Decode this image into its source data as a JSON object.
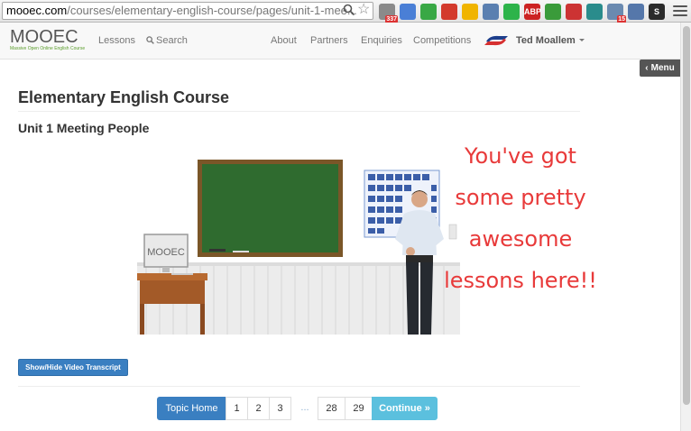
{
  "browser": {
    "url_host": "mooec.com",
    "url_path": "/courses/elementary-english-course/pages/unit-1-mee...",
    "extensions": [
      {
        "icon": "mail-icon",
        "badge": "337",
        "color": "#8a8a8a"
      },
      {
        "icon": "translate-icon",
        "badge": "",
        "color": "#4a7fd6"
      },
      {
        "icon": "evernote-icon",
        "badge": "",
        "color": "#39a845"
      },
      {
        "icon": "bookmark-red-icon",
        "badge": "",
        "color": "#d33a2c"
      },
      {
        "icon": "drive-icon",
        "badge": "",
        "color": "#f0b400"
      },
      {
        "icon": "clock-icon",
        "badge": "",
        "color": "#5a7fb0"
      },
      {
        "icon": "hangouts-icon",
        "badge": "",
        "color": "#2db34a"
      },
      {
        "icon": "adblock-icon",
        "label": "ABP",
        "badge": "",
        "color": "#c22"
      },
      {
        "icon": "feedly-icon",
        "badge": "",
        "color": "#3a9b3a"
      },
      {
        "icon": "plus-icon",
        "badge": "",
        "color": "#c33"
      },
      {
        "icon": "museum-icon",
        "badge": "",
        "color": "#2a8c8c"
      },
      {
        "icon": "calendar-icon",
        "badge": "15",
        "color": "#6a8ab0"
      },
      {
        "icon": "star-square-icon",
        "badge": "",
        "color": "#5577aa"
      },
      {
        "icon": "s-icon",
        "label": "S",
        "badge": "",
        "color": "#2b2b2b"
      }
    ]
  },
  "nav": {
    "logo_text": "MOOEC",
    "logo_tagline": "Massive Open Online English Course",
    "lessons": "Lessons",
    "search": "Search",
    "about": "About",
    "partners": "Partners",
    "enquiries": "Enquiries",
    "competitions": "Competitions",
    "user": "Ted Moallem"
  },
  "menu_label": "Menu",
  "course_title": "Elementary English Course",
  "unit_title": "Unit 1 Meeting People",
  "video": {
    "board_mac_label": "MOOEC"
  },
  "callout": {
    "line1": "You've got",
    "line2": "some pretty",
    "line3": "awesome",
    "line4": "lessons here!!",
    "color": "#e83a3a"
  },
  "transcript_button": "Show/Hide Video Transcript",
  "pager": {
    "home": "Topic Home",
    "p1": "1",
    "p2": "2",
    "p3": "3",
    "ellipsis": "...",
    "p28": "28",
    "p29": "29",
    "continue": "Continue »"
  },
  "colors": {
    "primary": "#3a7fc1",
    "info": "#5bc0de",
    "brand_green": "#5a9d2a"
  }
}
